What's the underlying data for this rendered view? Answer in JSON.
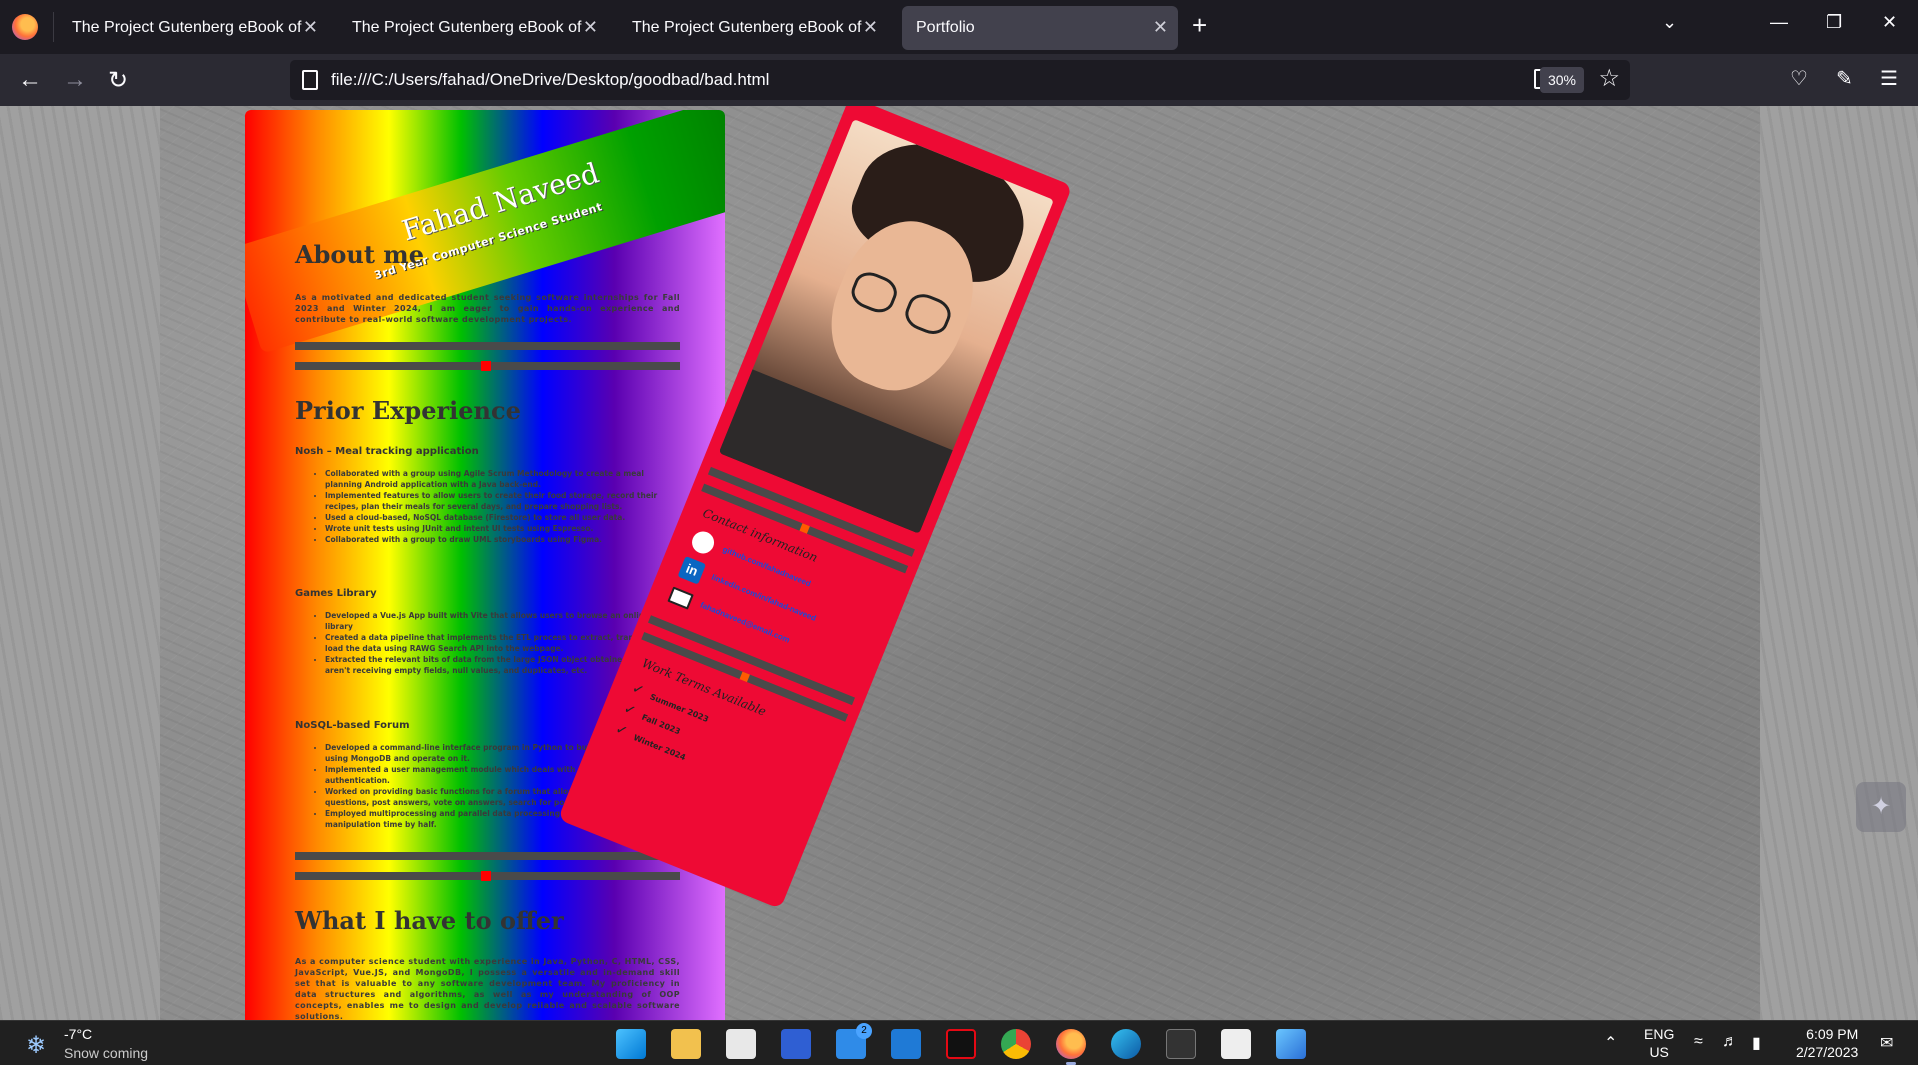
{
  "browser": {
    "tabs": [
      {
        "title": "The Project Gutenberg eBook of The",
        "active": false
      },
      {
        "title": "The Project Gutenberg eBook of Ro",
        "active": false
      },
      {
        "title": "The Project Gutenberg eBook of Dr",
        "active": false
      },
      {
        "title": "Portfolio",
        "active": true
      }
    ],
    "close_glyph": "✕",
    "new_tab_glyph": "+",
    "url": "file:///C:/Users/fahad/OneDrive/Desktop/goodbad/bad.html",
    "zoom": "30%"
  },
  "resume": {
    "name": "Fahad Naveed",
    "subtitle": "3rd Year Computer Science Student",
    "about_heading": "About me",
    "about_text": "As a motivated and dedicated student seeking software internships for Fall 2023 and Winter 2024, I am eager to gain hands-on experience and contribute to real-world software development projects.",
    "experience_heading": "Prior Experience",
    "jobs": [
      {
        "title": "Nosh – Meal tracking application",
        "bullets": [
          "Collaborated with a group using Agile Scrum Methodology to create a meal planning Android application with a Java back-end.",
          "Implemented features to allow users to create their food storage, record their recipes, plan their meals for several days, and prepare shopping lists.",
          "Used a cloud-based, NoSQL database (Firestore) to store all user data.",
          "Wrote unit tests using JUnit and intent UI tests using Espresso.",
          "Collaborated with a group to draw UML storyboards using Figma."
        ]
      },
      {
        "title": "Games Library",
        "bullets": [
          "Developed a Vue.js App built with Vite that allows users to browse an online games library",
          "Created a data pipeline that implements the ETL process to extract, transform, and load the data using RAWG Search API into the webpage.",
          "Extracted the relevant bits of data from the large JSON object obtained so we aren't receiving empty fields, null values, and duplicates, etc."
        ]
      },
      {
        "title": "NoSQL-based Forum",
        "bullets": [
          "Developed a command-line interface program in Python to build a document store using MongoDB and operate on it.",
          "Implemented a user management module which deals with registration and user authentication.",
          "Worked on providing basic functions for a forum that allows the users to post questions, post answers, vote on answers, search for posts, etc.",
          "Employed multiprocessing and parallel data processing techniques to cut database manipulation time by half."
        ]
      }
    ],
    "offer_heading": "What I have to offer",
    "offer_text": "As a computer science student with experience in Java, Python, C, HTML, CSS, JavaScript, Vue.JS, and MongoDB, I possess a versatile and in-demand skill set that is valuable to any software development team. My proficiency in data structures and algorithms, as well as my understanding of OOP concepts, enables me to design and develop reliable and scalable software solutions."
  },
  "profile": {
    "contact_heading": "Contact information",
    "contacts": [
      {
        "icon": "github-icon",
        "text": "github.com/fahadnaveed"
      },
      {
        "icon": "linkedin-icon",
        "text": "linkedin.com/in/fahad-naveed"
      },
      {
        "icon": "mail-icon",
        "text": "fahadnaveed@email.com"
      }
    ],
    "terms_heading": "Work Terms Available",
    "terms": [
      "Summer 2023",
      "Fall 2023",
      "Winter 2024"
    ],
    "check_glyph": "✓"
  },
  "taskbar": {
    "weather_temp": "-7°C",
    "weather_desc": "Snow coming",
    "lang_line1": "ENG",
    "lang_line2": "US",
    "time": "6:09 PM",
    "date": "2/27/2023",
    "mail_badge": "2"
  }
}
